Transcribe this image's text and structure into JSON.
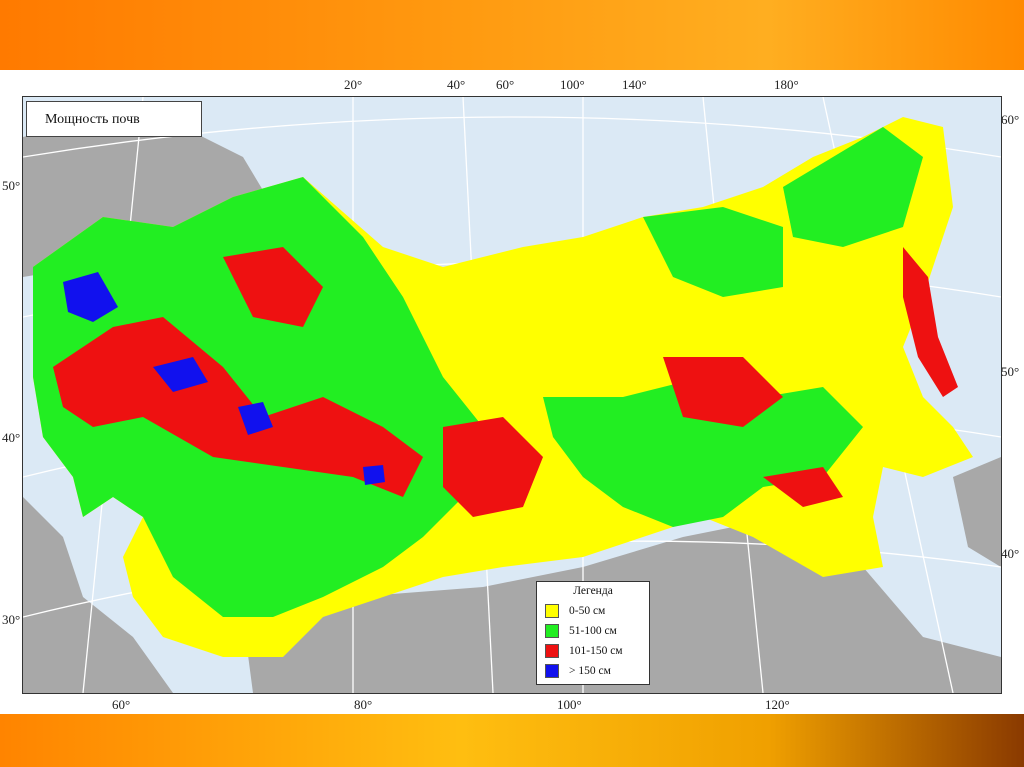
{
  "map": {
    "title": "Мощность почв",
    "legend": {
      "title": "Легенда",
      "items": [
        {
          "label": "0-50 см",
          "color": "#ffff00"
        },
        {
          "label": "51-100 см",
          "color": "#22ee22"
        },
        {
          "label": "101-150 см",
          "color": "#ee1111"
        },
        {
          "label": "> 150 см",
          "color": "#1111ee"
        }
      ]
    },
    "colors": {
      "sea": "#dbe9f5",
      "land_outside": "#a8a8a8",
      "graticule": "#ffffff"
    },
    "top_longitudes": [
      "20°",
      "40°",
      "60°",
      "100°",
      "140°",
      "180°"
    ],
    "bottom_longitudes": [
      "60°",
      "80°",
      "100°",
      "120°"
    ],
    "left_latitudes": [
      "50°",
      "40°",
      "30°"
    ],
    "right_latitudes": [
      "60°",
      "50°",
      "40°"
    ]
  }
}
